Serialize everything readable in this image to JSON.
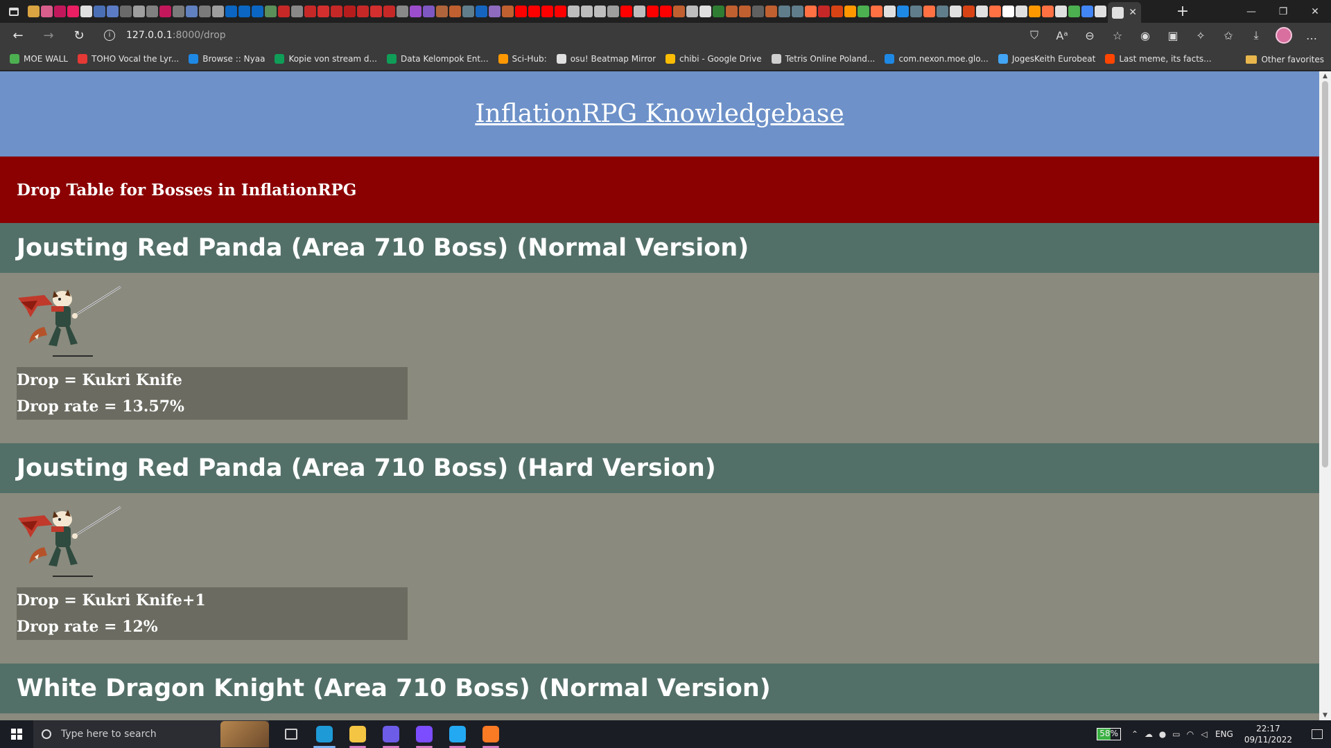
{
  "browser": {
    "tab_favicon_colors": [
      "#d9a441",
      "#d85e8c",
      "#c2185b",
      "#e91e63",
      "#e0e0e0",
      "#4a6fb5",
      "#5b7cc4",
      "#6a6a6a",
      "#9e9e9e",
      "#808080",
      "#c2185b",
      "#7a7a7a",
      "#6080c0",
      "#7a7a7a",
      "#9e9e9e",
      "#0a66c2",
      "#0a66c2",
      "#0a66c2",
      "#5a8f5a",
      "#c62828",
      "#888888",
      "#c62828",
      "#d32f2f",
      "#c62828",
      "#b71c1c",
      "#c62828",
      "#d32f2f",
      "#c62828",
      "#888888",
      "#9c4dcc",
      "#7e57c2",
      "#b0643b",
      "#c06030",
      "#607d8b",
      "#1565c0",
      "#8e6bbf",
      "#c06030",
      "#ff0000",
      "#ff0000",
      "#ff0000",
      "#ff0000",
      "#bdbdbd",
      "#bdbdbd",
      "#bdbdbd",
      "#9e9e9e",
      "#ff0000",
      "#bdbdbd",
      "#ff0000",
      "#ff0000",
      "#c06030",
      "#bdbdbd",
      "#e0e0e0",
      "#2e7d32",
      "#c06030",
      "#c06030",
      "#606060",
      "#c06030",
      "#607d8b",
      "#607d8b",
      "#ff7043",
      "#c62828",
      "#d84315",
      "#ff9800",
      "#4caf50",
      "#ff7043",
      "#e0e0e0",
      "#1e88e5",
      "#607d8b",
      "#ff7043",
      "#607d8b",
      "#e0e0e0",
      "#d84315",
      "#e0e0e0",
      "#ff7043",
      "#ffffff",
      "#e0e0e0",
      "#ff9800",
      "#ff7043",
      "#e0e0e0",
      "#4caf50",
      "#4285f4",
      "#e0e0e0"
    ],
    "active_tab_favicon_color": "#e0e0e0",
    "new_tab_label": "+",
    "window_controls": {
      "minimize": "—",
      "restore": "❐",
      "close": "✕"
    },
    "toolbar": {
      "back_icon": "←",
      "forward_icon": "→",
      "reload_icon": "↻",
      "url_host": "127.0.0.1",
      "url_path": ":8000/drop",
      "info_icon": "i",
      "right_icons": [
        "⛉",
        "Aᵃ",
        "⊖",
        "☆",
        "◉",
        "▣",
        "✧",
        "✩",
        "⤓",
        "…"
      ]
    },
    "bookmarks": [
      {
        "label": "MOE WALL",
        "icon_color": "#4caf50"
      },
      {
        "label": "TOHO Vocal the Lyr...",
        "icon_color": "#e53935"
      },
      {
        "label": "Browse :: Nyaa",
        "icon_color": "#1e88e5"
      },
      {
        "label": "Kopie von stream d...",
        "icon_color": "#0f9d58"
      },
      {
        "label": "Data Kelompok Ent...",
        "icon_color": "#0f9d58"
      },
      {
        "label": "Sci-Hub:",
        "icon_color": "#ff9800"
      },
      {
        "label": "osu! Beatmap Mirror",
        "icon_color": "#e0e0e0"
      },
      {
        "label": "chibi - Google Drive",
        "icon_color": "#fbbc04"
      },
      {
        "label": "Tetris Online Poland...",
        "icon_color": "#cfcfcf"
      },
      {
        "label": "com.nexon.moe.glo...",
        "icon_color": "#1e88e5"
      },
      {
        "label": "JogesKeith Eurobeat",
        "icon_color": "#42a5f5"
      },
      {
        "label": "Last meme, its facts...",
        "icon_color": "#ff4500"
      }
    ],
    "other_favorites": "Other favorites"
  },
  "page": {
    "site_title": "InflationRPG Knowledgebase",
    "banner_title": "Drop Table for Bosses in InflationRPG",
    "bosses": [
      {
        "name": "Jousting Red Panda (Area 710 Boss) (Normal Version)",
        "drop": "Drop = Kukri Knife",
        "rate": "Drop rate = 13.57%"
      },
      {
        "name": "Jousting Red Panda (Area 710 Boss) (Hard Version)",
        "drop": "Drop = Kukri Knife+1",
        "rate": "Drop rate = 12%"
      },
      {
        "name": "White Dragon Knight (Area 710 Boss) (Normal Version)"
      }
    ]
  },
  "taskbar": {
    "search_placeholder": "Type here to search",
    "apps": [
      {
        "name": "task-view",
        "color": "#cfcfcf"
      },
      {
        "name": "edge",
        "color": "#1e9bd7"
      },
      {
        "name": "file-explorer",
        "color": "#f4c542"
      },
      {
        "name": "discord",
        "color": "#6c5ce7"
      },
      {
        "name": "github",
        "color": "#7c4dff"
      },
      {
        "name": "vscode",
        "color": "#23a9f2"
      },
      {
        "name": "xampp",
        "color": "#fb7a24"
      }
    ],
    "battery": "58%",
    "language": "ENG",
    "time": "22:17",
    "date": "09/11/2022"
  }
}
